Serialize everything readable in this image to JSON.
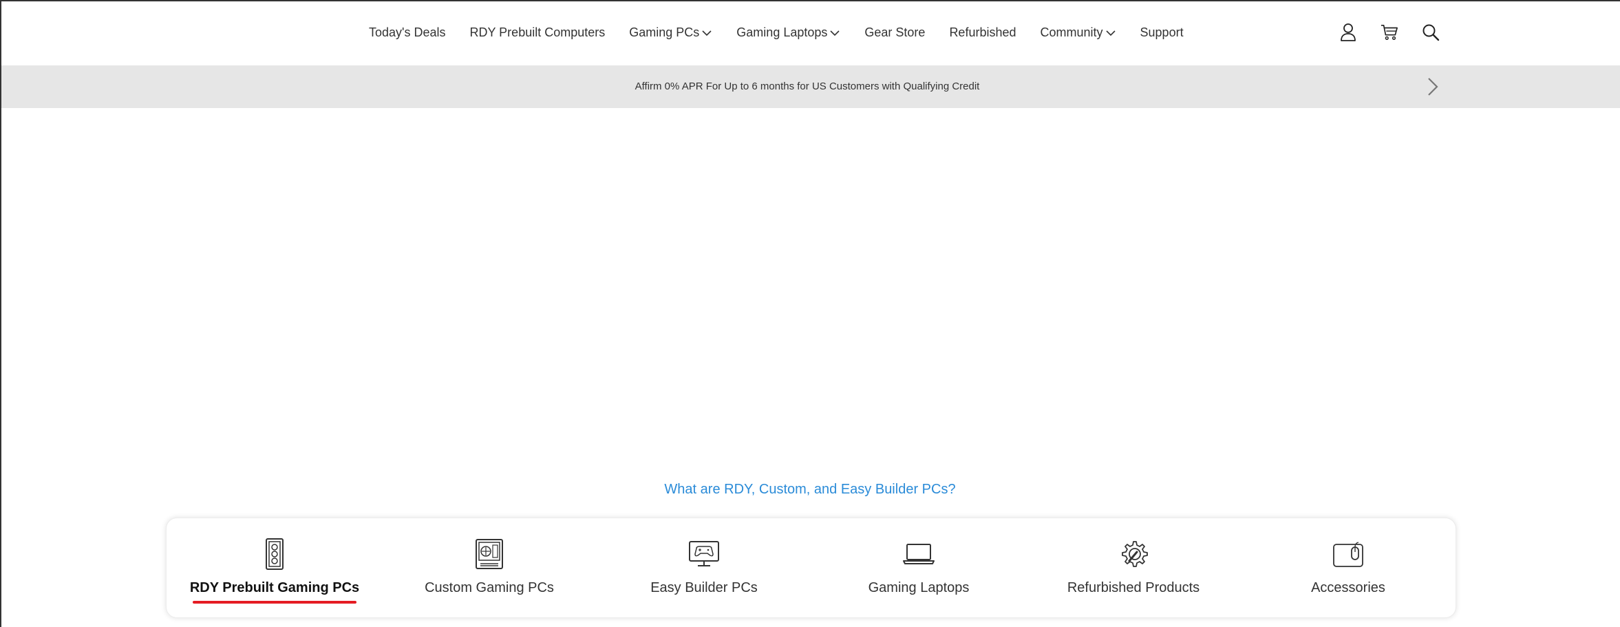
{
  "nav": {
    "items": [
      {
        "label": "Today's Deals",
        "dropdown": false
      },
      {
        "label": "RDY Prebuilt Computers",
        "dropdown": false
      },
      {
        "label": "Gaming PCs",
        "dropdown": true
      },
      {
        "label": "Gaming Laptops",
        "dropdown": true
      },
      {
        "label": "Gear Store",
        "dropdown": false
      },
      {
        "label": "Refurbished",
        "dropdown": false
      },
      {
        "label": "Community",
        "dropdown": true
      },
      {
        "label": "Support",
        "dropdown": false
      }
    ],
    "icons": [
      "user-icon",
      "cart-icon",
      "search-icon"
    ]
  },
  "promo": {
    "text": "Affirm 0% APR For Up to 6 months for US Customers with Qualifying Credit",
    "next_icon": "chevron-right-icon"
  },
  "info_link": "What are RDY, Custom, and Easy Builder PCs?",
  "categories": [
    {
      "label": "RDY Prebuilt Gaming PCs",
      "icon": "pc-tower-icon",
      "active": true
    },
    {
      "label": "Custom Gaming PCs",
      "icon": "custom-pc-icon",
      "active": false
    },
    {
      "label": "Easy Builder PCs",
      "icon": "monitor-gamepad-icon",
      "active": false
    },
    {
      "label": "Gaming Laptops",
      "icon": "laptop-icon",
      "active": false
    },
    {
      "label": "Refurbished Products",
      "icon": "gear-wrench-icon",
      "active": false
    },
    {
      "label": "Accessories",
      "icon": "mouse-pad-icon",
      "active": false
    }
  ],
  "colors": {
    "accent_red": "#e51c23",
    "link_blue": "#2a8bd8",
    "promo_bg": "#e6e6e6"
  }
}
